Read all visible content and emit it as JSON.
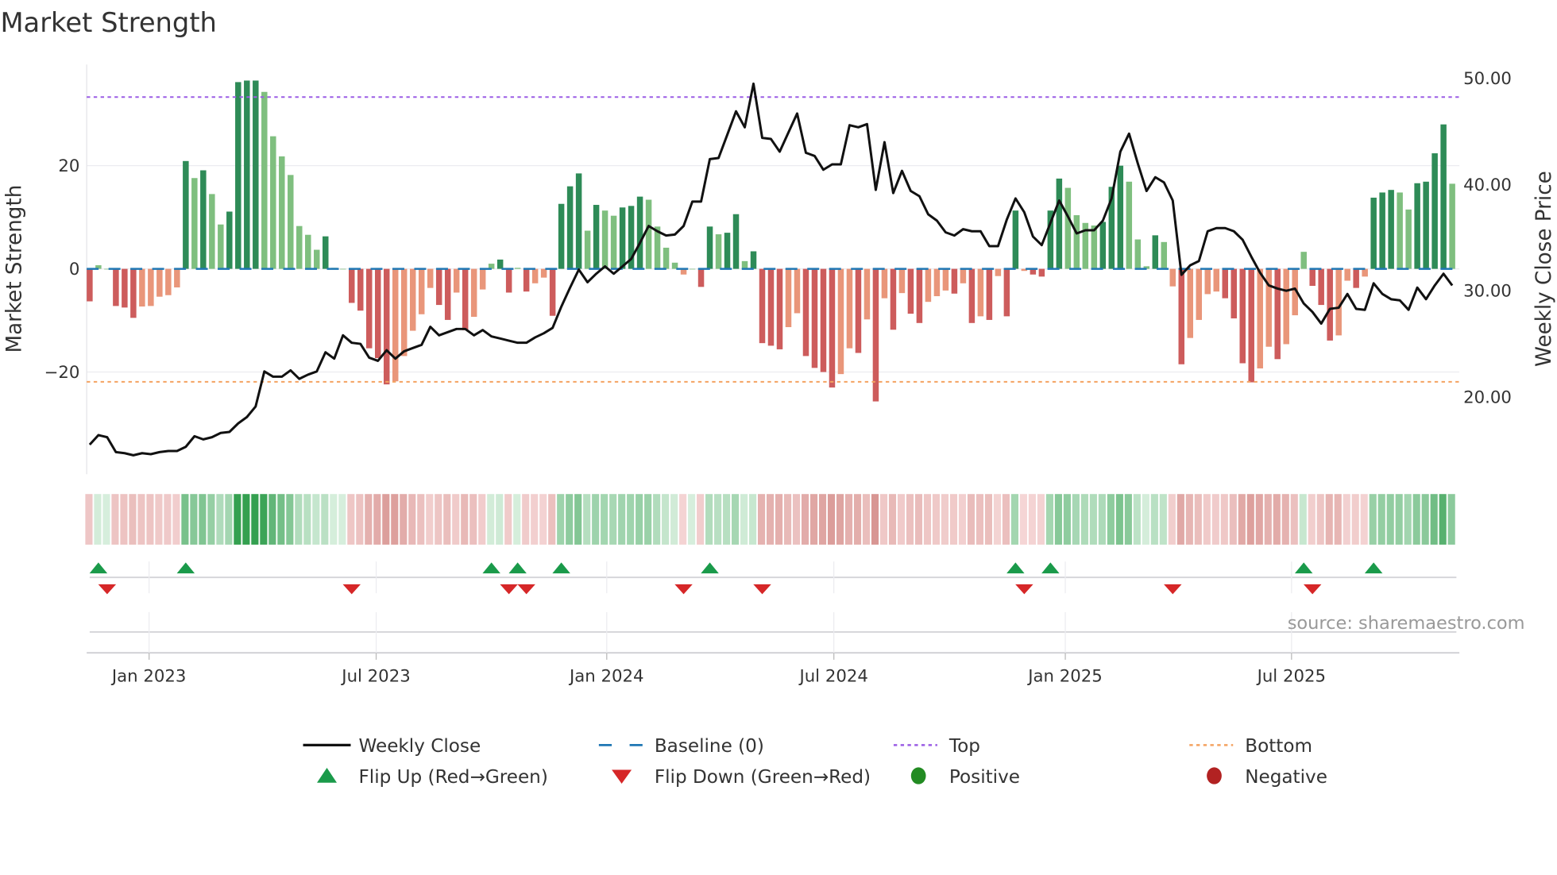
{
  "chart_data": {
    "type": "bar",
    "title": "Market Strength",
    "ylabel": "Market Strength",
    "y2label": "Weekly Close Price",
    "ylim": [
      -40,
      40
    ],
    "y2lim": [
      12,
      52
    ],
    "yticks": [
      "20",
      "0",
      "−20"
    ],
    "ytick_values": [
      20,
      0,
      -20
    ],
    "y2ticks": [
      "50.00",
      "40.00",
      "30.00",
      "20.00"
    ],
    "y2tick_values": [
      50,
      40,
      30,
      20
    ],
    "xticks": [
      "Jan 2023",
      "Jul 2023",
      "Jan 2024",
      "Jul 2024",
      "Jan 2025",
      "Jul 2025"
    ],
    "xtick_week_index": [
      6.8,
      32.8,
      59.2,
      85.2,
      111.7,
      137.6
    ],
    "top_level": 33.3,
    "bottom_level": -21.9,
    "baseline": 0,
    "strength": [
      -6.3,
      0.7,
      0,
      -7.2,
      -7.5,
      -9.5,
      -7.3,
      -7.2,
      -5.4,
      -5.1,
      -3.6,
      20.9,
      17.6,
      19.1,
      14.5,
      8.6,
      11.1,
      36.2,
      36.5,
      36.5,
      34.3,
      25.7,
      21.8,
      18.2,
      8.3,
      6.6,
      3.7,
      6.3,
      0.2,
      0,
      -6.6,
      -8.1,
      -15.4,
      -17.3,
      -22.4,
      -21.8,
      -16.9,
      -12.0,
      -8.8,
      -3.7,
      -7.0,
      -9.9,
      -4.6,
      -11.9,
      -9.3,
      -4.0,
      1.0,
      1.8,
      -4.6,
      0.2,
      -4.4,
      -2.8,
      -1.7,
      -9.1,
      12.6,
      16.0,
      18.5,
      7.4,
      12.4,
      11.3,
      10.3,
      11.9,
      12.2,
      14.0,
      13.4,
      8.2,
      4.1,
      1.2,
      -1.1,
      0,
      -3.5,
      8.2,
      6.7,
      7.0,
      10.6,
      1.5,
      3.4,
      -14.4,
      -14.9,
      -15.6,
      -11.3,
      -8.6,
      -16.9,
      -19.2,
      -20.0,
      -23.0,
      -20.4,
      -15.4,
      -16.3,
      -9.8,
      -25.7,
      -5.7,
      -11.8,
      -4.7,
      -8.7,
      -10.5,
      -6.4,
      -5.3,
      -4.2,
      -4.8,
      -2.8,
      -10.5,
      -9.2,
      -9.9,
      -1.4,
      -9.2,
      11.3,
      -0.4,
      -1.1,
      -1.5,
      11.3,
      17.5,
      15.7,
      10.4,
      8.9,
      8.4,
      9.1,
      15.9,
      20.0,
      16.9,
      5.7,
      0.5,
      6.5,
      5.2,
      -3.4,
      -18.5,
      -13.4,
      -9.9,
      -4.9,
      -4.4,
      -5.7,
      -9.6,
      -18.3,
      -22.0,
      -19.3,
      -15.1,
      -17.5,
      -14.6,
      -9.0,
      3.3,
      -3.3,
      -7.0,
      -13.9,
      -12.9,
      -2.3,
      -3.7,
      -1.5,
      13.8,
      14.8,
      15.3,
      14.8,
      11.5,
      16.6,
      16.9,
      22.4,
      28.0,
      16.5
    ],
    "close": [
      15.4,
      16.3,
      16.1,
      14.7,
      14.6,
      14.4,
      14.6,
      14.5,
      14.7,
      14.8,
      14.8,
      15.2,
      16.2,
      15.9,
      16.1,
      16.5,
      16.6,
      17.4,
      18.0,
      19.0,
      22.3,
      21.8,
      21.8,
      22.4,
      21.6,
      22.0,
      22.3,
      24.1,
      23.5,
      25.7,
      25.0,
      24.9,
      23.6,
      23.3,
      24.3,
      23.5,
      24.2,
      24.5,
      24.8,
      26.5,
      25.7,
      26.0,
      26.3,
      26.3,
      25.7,
      26.2,
      25.6,
      25.4,
      25.2,
      25.0,
      25.0,
      25.5,
      25.9,
      26.4,
      28.4,
      30.2,
      31.9,
      30.7,
      31.5,
      32.2,
      31.5,
      32.2,
      32.9,
      34.4,
      36.0,
      35.5,
      35.1,
      35.2,
      36.0,
      38.3,
      38.3,
      42.3,
      42.4,
      44.6,
      46.8,
      45.3,
      49.4,
      44.3,
      44.2,
      43.0,
      44.8,
      46.6,
      42.9,
      42.6,
      41.3,
      41.8,
      41.8,
      45.5,
      45.3,
      45.6,
      39.4,
      43.9,
      39.1,
      41.2,
      39.3,
      38.8,
      37.1,
      36.5,
      35.4,
      35.1,
      35.7,
      35.5,
      35.5,
      34.1,
      34.1,
      36.6,
      38.6,
      37.3,
      35.0,
      34.2,
      36.3,
      38.4,
      36.9,
      35.3,
      35.6,
      35.6,
      36.5,
      38.6,
      43.0,
      44.7,
      41.9,
      39.3,
      40.6,
      40.1,
      38.4,
      31.4,
      32.3,
      32.7,
      35.5,
      35.8,
      35.8,
      35.5,
      34.7,
      33.1,
      31.6,
      30.4,
      30.1,
      29.9,
      30.1,
      28.7,
      27.9,
      26.8,
      28.2,
      28.3,
      29.6,
      28.2,
      28.1,
      30.6,
      29.6,
      29.1,
      29.0,
      28.1,
      30.2,
      29.1,
      30.4,
      31.5,
      30.4
    ],
    "flip_up_index": [
      1,
      11,
      46,
      49,
      54,
      71,
      106,
      110,
      139,
      147
    ],
    "flip_down_index": [
      2,
      30,
      48,
      50,
      68,
      77,
      107,
      124,
      140
    ],
    "legend": [
      {
        "label": "Weekly Close",
        "symbol": "line",
        "color": "#111111"
      },
      {
        "label": "Baseline (0)",
        "symbol": "dash",
        "color": "#1f77b4"
      },
      {
        "label": "Top",
        "symbol": "dot",
        "color": "#9b5de5"
      },
      {
        "label": "Bottom",
        "symbol": "dot",
        "color": "#f4a261"
      },
      {
        "label": "Flip Up (Red→Green)",
        "symbol": "triangle-up",
        "color": "#1a9a4a"
      },
      {
        "label": "Flip Down (Green→Red)",
        "symbol": "triangle-down",
        "color": "#d62728"
      },
      {
        "label": "Positive",
        "symbol": "circle",
        "color": "#228b22"
      },
      {
        "label": "Negative",
        "symbol": "circle",
        "color": "#b22222"
      }
    ],
    "legend_position": "bottom",
    "colors": {
      "pos_dark": "#2e8b57",
      "pos_light": "#7fbf7f",
      "neg_dark": "#cd5c5c",
      "neg_light": "#e9967a"
    }
  },
  "source": "source: sharemaestro.com"
}
